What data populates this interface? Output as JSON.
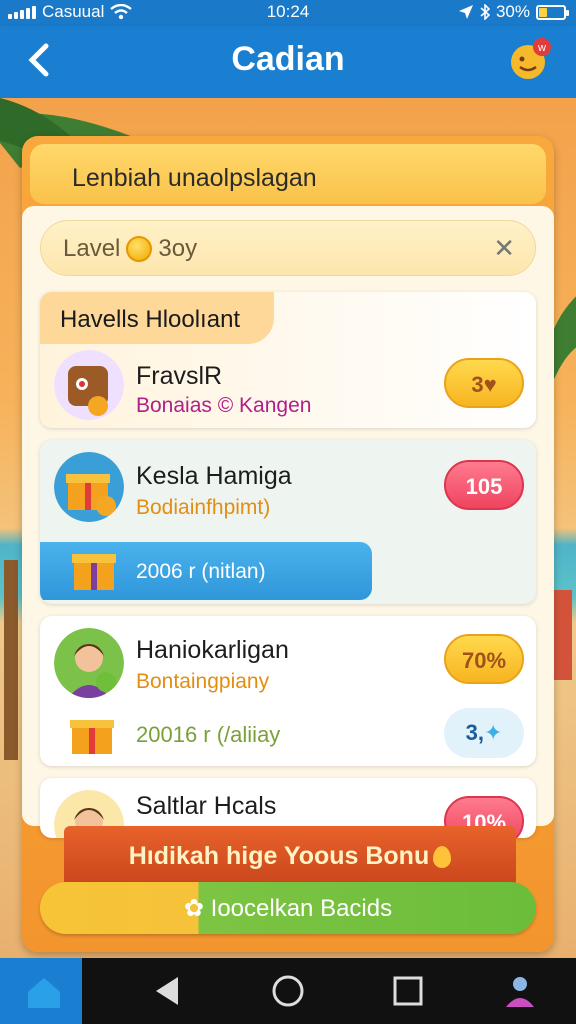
{
  "status_bar": {
    "carrier": "Casuual",
    "time": "10:24",
    "battery": "30%"
  },
  "header": {
    "title": "Cadian",
    "badge": "w"
  },
  "panel": {
    "title": "Lenbiah unaolpslagan",
    "level_label": "Lavel",
    "level_value": "3oy",
    "section_tag": "Havells Hloolıant"
  },
  "cards": [
    {
      "name": "FravslR",
      "subtitle": "Bonaias © Kangen",
      "subtitle_color": "#b0208a",
      "badge": "3",
      "badge_color": "yellow"
    },
    {
      "name": "Kesla Hamiga",
      "subtitle": "Bodiainfhpimt)",
      "subtitle_color": "#e38e12",
      "badge": "105",
      "badge_color": "red",
      "progress_text": "2006 r (nitlan)",
      "progress": 0.67
    },
    {
      "name": "Haniokarligan",
      "subtitle": "Bontaingpiany",
      "subtitle_color": "#e38e12",
      "badge": "70%",
      "badge_color": "yellow",
      "reward_text": "20016 r (/aliiay",
      "reward_badge": "3,"
    },
    {
      "name": "Saltlar Hcals",
      "badge": "10%",
      "badge_color": "red"
    }
  ],
  "banner": {
    "text": "Hıdikah hige Yoous Bonu"
  },
  "cta": {
    "label": "Ioocelkan Bacids"
  },
  "colors": {
    "header": "#1b7fd1",
    "panel": "#f5a03a",
    "accent_green": "#7dc443"
  }
}
